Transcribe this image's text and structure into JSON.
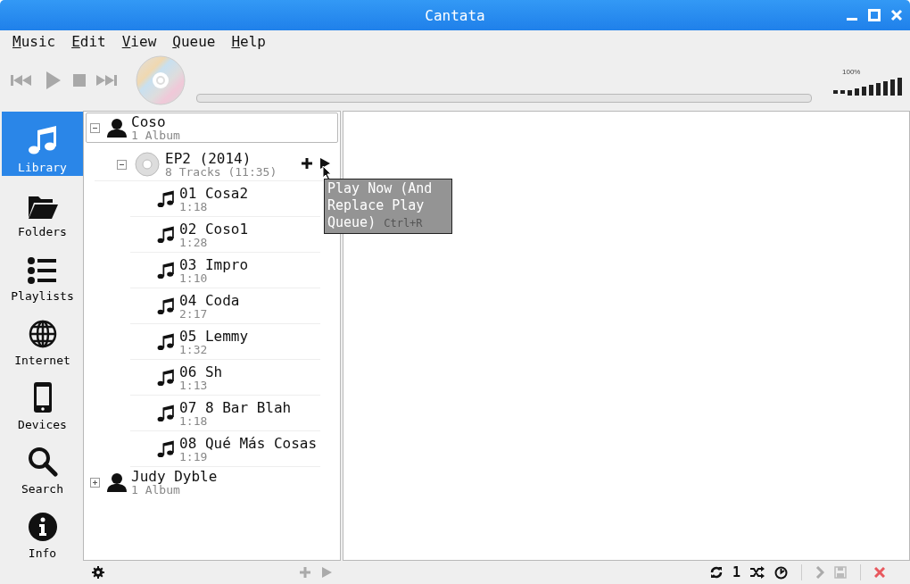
{
  "window": {
    "title": "Cantata"
  },
  "menu": [
    {
      "label": "Music"
    },
    {
      "label": "Edit"
    },
    {
      "label": "View"
    },
    {
      "label": "Queue"
    },
    {
      "label": "Help"
    }
  ],
  "progress": {
    "level": 0
  },
  "volume": {
    "label": "100%",
    "level": 1
  },
  "sidebar": {
    "items": [
      {
        "label": "Library",
        "kind": "library",
        "selected": true
      },
      {
        "label": "Folders",
        "kind": "folders",
        "selected": false
      },
      {
        "label": "Playlists",
        "kind": "playlists",
        "selected": false
      },
      {
        "label": "Internet",
        "kind": "internet",
        "selected": false
      },
      {
        "label": "Devices",
        "kind": "devices",
        "selected": false
      },
      {
        "label": "Search",
        "kind": "search",
        "selected": false
      },
      {
        "label": "Info",
        "kind": "info",
        "selected": false
      }
    ]
  },
  "library": {
    "artists": [
      {
        "name": "Coso",
        "detail": "1 Album",
        "selected": true,
        "expanded": true,
        "albums": [
          {
            "title": "EP2 (2014)",
            "detail": "8 Tracks (11:35)",
            "expanded": true,
            "tracks": [
              {
                "title": "01 Cosa2",
                "duration": "1:18"
              },
              {
                "title": "02 Coso1",
                "duration": "1:28"
              },
              {
                "title": "03 Impro",
                "duration": "1:10"
              },
              {
                "title": "04 Coda",
                "duration": "2:17"
              },
              {
                "title": "05 Lemmy",
                "duration": "1:32"
              },
              {
                "title": "06 Sh",
                "duration": "1:13"
              },
              {
                "title": "07 8 Bar Blah",
                "duration": "1:18"
              },
              {
                "title": "08 Qué Más Cosas",
                "duration": "1:19"
              }
            ]
          }
        ]
      },
      {
        "name": "Judy Dyble",
        "detail": "1 Album",
        "selected": false,
        "expanded": false
      }
    ]
  },
  "tooltip": {
    "text": "Play Now (And Replace Play Queue)",
    "shortcut": "Ctrl+R"
  },
  "status_bar": {
    "single_label": "1"
  }
}
